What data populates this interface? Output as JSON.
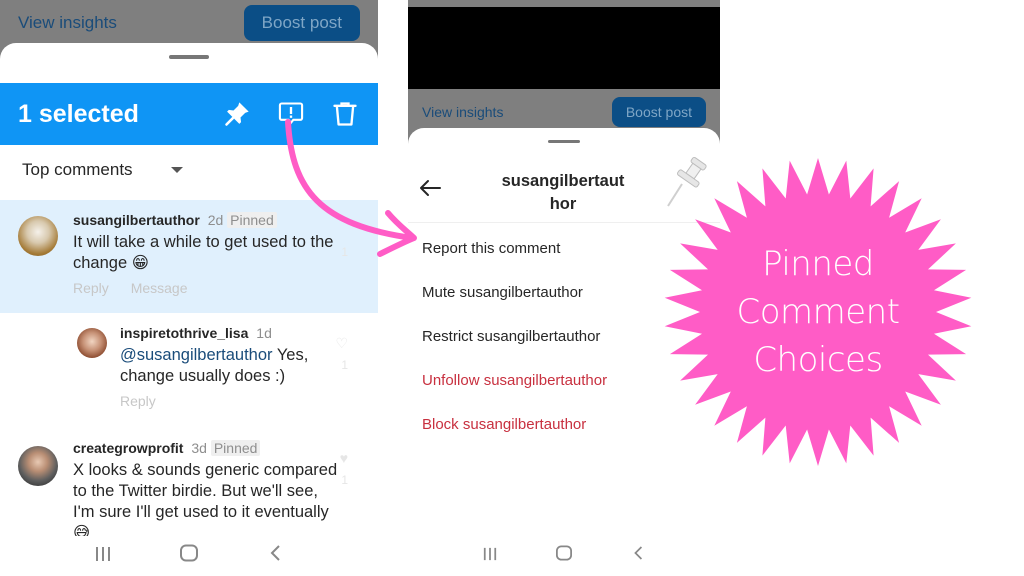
{
  "left_screen": {
    "background_bar": {
      "link": "View insights",
      "button": "Boost post"
    },
    "selection_bar": {
      "title": "1 selected",
      "actions": [
        {
          "name": "pin-icon",
          "label": "Pin"
        },
        {
          "name": "report-icon",
          "label": "Report"
        },
        {
          "name": "trash-icon",
          "label": "Delete"
        }
      ]
    },
    "filter": {
      "label": "Top comments"
    },
    "comments": [
      {
        "user": "susangilbertauthor",
        "age": "2d",
        "badge": "Pinned",
        "text": "It will take a while to get used to the change 😁",
        "actions": [
          "Reply",
          "Message"
        ],
        "likes": "1",
        "selected": true
      },
      {
        "user": "inspiretothrive_lisa",
        "age": "1d",
        "badge": "",
        "mention": "@susangilbertauthor",
        "text": "Yes, change usually does :)",
        "actions": [
          "Reply"
        ],
        "likes": "1",
        "selected": false
      },
      {
        "user": "creategrowprofit",
        "age": "3d",
        "badge": "Pinned",
        "text": "X looks & sounds generic compared to the Twitter birdie. But we'll see, I'm sure I'll get used to it eventually 😅",
        "actions": [],
        "likes": "1",
        "selected": false
      }
    ]
  },
  "right_screen": {
    "background_bar": {
      "link": "View insights",
      "button": "Boost post"
    },
    "menu": {
      "title": "susangilbertauthor",
      "items": [
        {
          "label": "Report this comment",
          "danger": false
        },
        {
          "label": "Mute susangilbertauthor",
          "danger": false
        },
        {
          "label": "Restrict susangilbertauthor",
          "danger": false
        },
        {
          "label": "Unfollow susangilbertauthor",
          "danger": true
        },
        {
          "label": "Block susangilbertauthor",
          "danger": true
        }
      ]
    }
  },
  "nav_bar": {
    "icons": [
      "recent-apps-icon",
      "home-icon",
      "back-icon"
    ]
  },
  "badge": {
    "lines": [
      "Pinned",
      "Comment",
      "Choices"
    ],
    "color": "#ff5cc6"
  },
  "colors": {
    "selection_blue": "#0f95f5",
    "selected_row": "#e0f0fd",
    "danger_red": "#c8303f",
    "arrow_pink": "#ff5cc6"
  }
}
